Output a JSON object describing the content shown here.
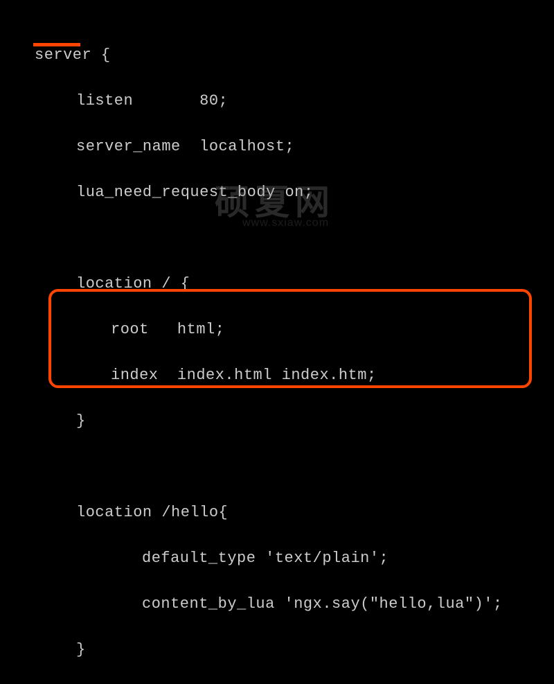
{
  "code": {
    "l1": "server {",
    "l2": "listen       80;",
    "l3": "server_name  localhost;",
    "l4": "lua_need_request_body on;",
    "l5": "",
    "l6": "",
    "l7": "location / {",
    "l8": "root   html;",
    "l9": "index  index.html index.htm;",
    "l10": "}",
    "l11": "",
    "l12": "",
    "l13": "location /hello{",
    "l14": "default_type 'text/plain';",
    "l15": "content_by_lua 'ngx.say(\"hello,lua\")';",
    "l16": "}"
  },
  "watermark": {
    "cn": "硕夏网",
    "url": "www.sxiaw.com"
  },
  "accent_color": "#ff4500"
}
